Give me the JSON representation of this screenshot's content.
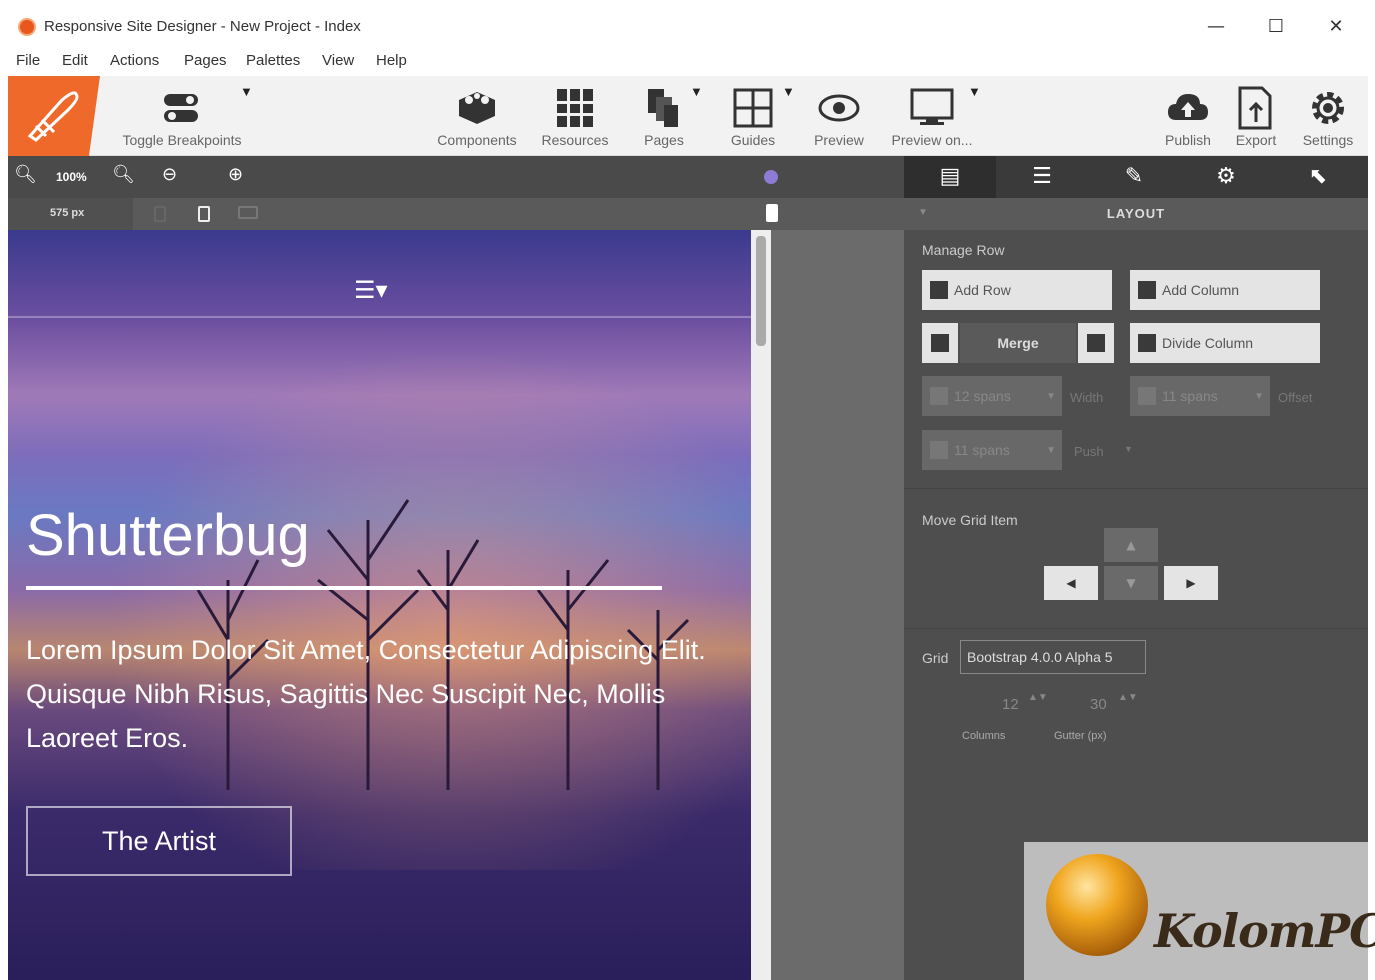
{
  "window": {
    "title": "Responsive Site Designer - New Project - Index",
    "minimize": "—",
    "maximize": "☐",
    "close": "✕"
  },
  "menu": [
    "File",
    "Edit",
    "Actions",
    "Pages",
    "Palettes",
    "View",
    "Help"
  ],
  "toolbar": {
    "toggle_breakpoints": "Toggle Breakpoints",
    "components": "Components",
    "resources": "Resources",
    "pages": "Pages",
    "guides": "Guides",
    "preview": "Preview",
    "preview_on": "Preview on...",
    "publish": "Publish",
    "export": "Export",
    "settings": "Settings"
  },
  "zoom": {
    "level": "100%"
  },
  "breakpoint": {
    "width": "575 px"
  },
  "canvas": {
    "headline": "Shutterbug",
    "paragraph": "Lorem Ipsum Dolor Sit Amet, Consectetur Adipiscing Elit. Quisque Nibh Risus, Sagittis Nec Suscipit Nec, Mollis Laoreet Eros.",
    "button": "The Artist"
  },
  "panel": {
    "section_title": "LAYOUT",
    "manage_row": "Manage Row",
    "add_row": "Add Row",
    "add_column": "Add Column",
    "merge": "Merge",
    "divide_column": "Divide Column",
    "width_value": "12 spans",
    "width_label": "Width",
    "offset_value": "11 spans",
    "offset_label": "Offset",
    "push_value": "11 spans",
    "push_label": "Push",
    "move_grid_item": "Move Grid Item",
    "grid_label": "Grid",
    "grid_value": "Bootstrap 4.0.0 Alpha 5",
    "columns_value": "12",
    "columns_label": "Columns",
    "gutter_value": "30",
    "gutter_label": "Gutter (px)"
  },
  "watermark": {
    "text": "KolomPC"
  },
  "colors": {
    "accent": "#ef6a2a",
    "panel_bg": "#4e4e4e",
    "zoom_marker": "#8e7bd6"
  }
}
